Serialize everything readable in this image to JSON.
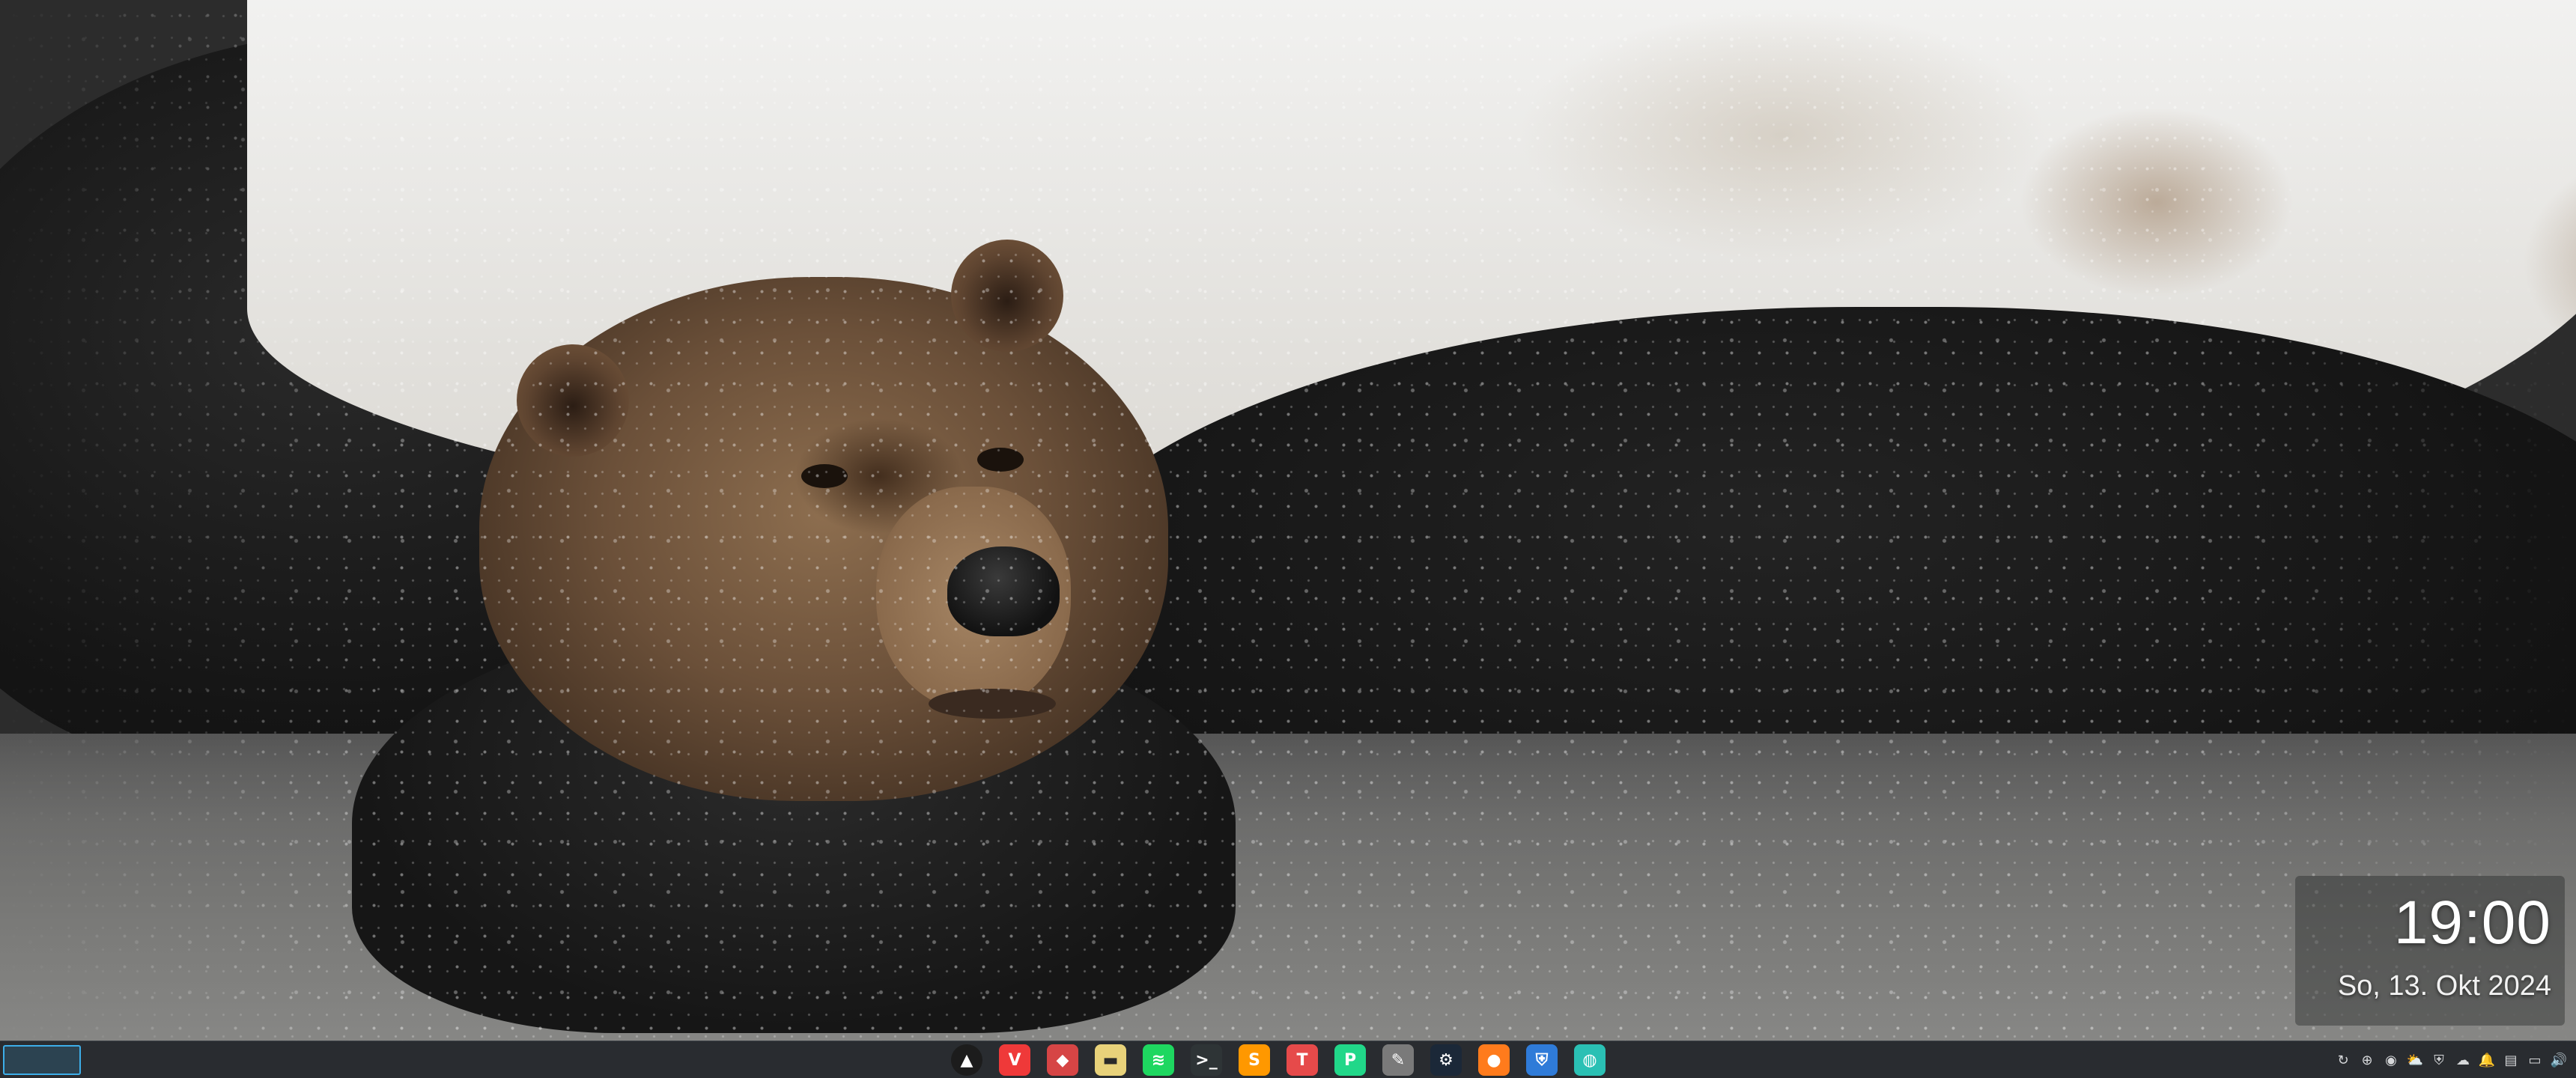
{
  "clock": {
    "time": "19:00",
    "date": "So, 13. Okt 2024"
  },
  "taskbar": {
    "pager": {
      "active_desktop": 1
    },
    "apps": [
      {
        "name": "launcher-icon",
        "glyph": "▲",
        "color": "#ffffff",
        "bg": "#1c1c1c"
      },
      {
        "name": "vivaldi-icon",
        "glyph": "V",
        "color": "#ffffff",
        "bg": "#ef3939"
      },
      {
        "name": "code-editor-icon",
        "glyph": "◆",
        "color": "#ffffff",
        "bg": "#d64545"
      },
      {
        "name": "file-manager-icon",
        "glyph": "▬",
        "color": "#2a2a2a",
        "bg": "#e8d27a"
      },
      {
        "name": "spotify-icon",
        "glyph": "≋",
        "color": "#ffffff",
        "bg": "#1ed760"
      },
      {
        "name": "terminal-icon",
        "glyph": ">_",
        "color": "#ffffff",
        "bg": "#2e3436"
      },
      {
        "name": "sublime-icon",
        "glyph": "S",
        "color": "#ffffff",
        "bg": "#ff9800"
      },
      {
        "name": "jetbrains-toolbox-icon",
        "glyph": "T",
        "color": "#ffffff",
        "bg": "#e64a4a"
      },
      {
        "name": "pycharm-icon",
        "glyph": "P",
        "color": "#ffffff",
        "bg": "#21d789"
      },
      {
        "name": "text-editor-icon",
        "glyph": "✎",
        "color": "#ffffff",
        "bg": "#7a7a7a"
      },
      {
        "name": "steam-icon",
        "glyph": "⚙",
        "color": "#ffffff",
        "bg": "#1b2838"
      },
      {
        "name": "game-launcher-icon",
        "glyph": "●",
        "color": "#ffffff",
        "bg": "#ff7b1c"
      },
      {
        "name": "password-manager-icon",
        "glyph": "⛨",
        "color": "#ffffff",
        "bg": "#2f7bd8"
      },
      {
        "name": "messenger-icon",
        "glyph": "◍",
        "color": "#ffffff",
        "bg": "#2ac0b4"
      }
    ],
    "tray": [
      {
        "name": "sync-icon",
        "glyph": "↻"
      },
      {
        "name": "updates-icon",
        "glyph": "⊕"
      },
      {
        "name": "discord-icon",
        "glyph": "◉"
      },
      {
        "name": "cloud-sync-icon",
        "glyph": "⛅"
      },
      {
        "name": "vpn-icon",
        "glyph": "⛨"
      },
      {
        "name": "weather-icon",
        "glyph": "☁"
      },
      {
        "name": "notifications-icon",
        "glyph": "🔔"
      },
      {
        "name": "clipboard-icon",
        "glyph": "▤"
      },
      {
        "name": "display-icon",
        "glyph": "▭"
      },
      {
        "name": "volume-icon",
        "glyph": "🔊"
      }
    ]
  },
  "colors": {
    "taskbar_bg": "#2a2e32",
    "accent": "#3daee9"
  }
}
